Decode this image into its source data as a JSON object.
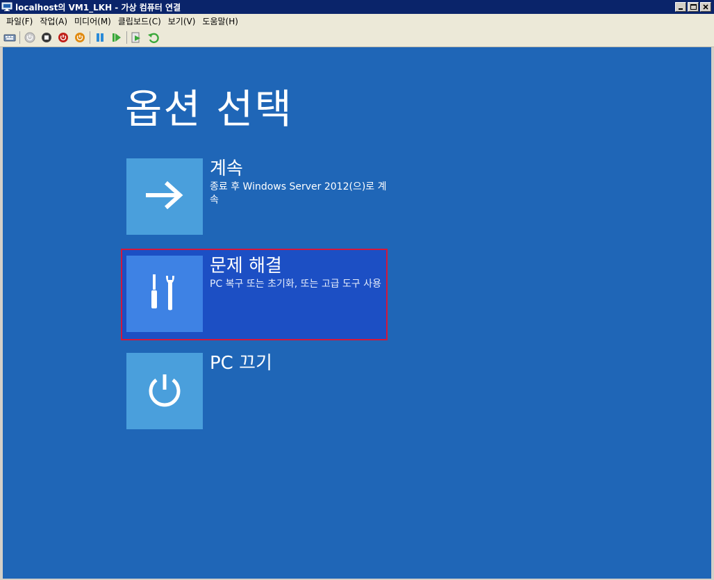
{
  "window": {
    "title": "localhost의 VM1_LKH - 가상 컴퓨터 연결",
    "controls": [
      "minimize",
      "maximize",
      "close"
    ]
  },
  "menu": {
    "items": [
      "파일(F)",
      "작업(A)",
      "미디어(M)",
      "클립보드(C)",
      "보기(V)",
      "도움말(H)"
    ]
  },
  "toolbar": {
    "icons": [
      "ctrl-alt-del-icon",
      "start-icon",
      "turn-off-icon",
      "shutdown-icon",
      "save-icon",
      "pause-icon",
      "resume-icon",
      "snapshot-icon",
      "revert-icon"
    ]
  },
  "screen": {
    "title": "옵션 선택",
    "options": [
      {
        "title": "계속",
        "desc": "종료 후 Windows Server 2012(으)로 계속",
        "icon": "arrow-right-icon"
      },
      {
        "title": "문제 해결",
        "desc": "PC 복구 또는 초기화, 또는 고급 도구 사용",
        "icon": "tools-icon",
        "selected": true
      },
      {
        "title": "PC 끄기",
        "desc": "",
        "icon": "power-icon"
      }
    ]
  },
  "colors": {
    "titlebar": "#0a246a",
    "screen_bg": "#1f66b7",
    "tile": "#4a9fdc",
    "selected_bg": "#1c4fc4",
    "selected_border": "#d6163a"
  }
}
